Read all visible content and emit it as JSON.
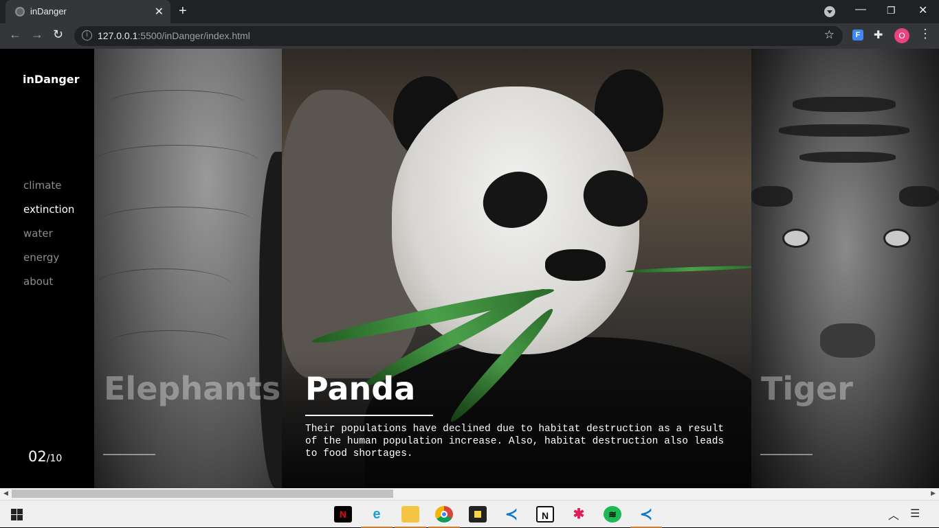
{
  "browser": {
    "tab_title": "inDanger",
    "url_host": "127.0.0.1",
    "url_rest": ":5500/inDanger/index.html",
    "avatar_letter": "O"
  },
  "site": {
    "logo": "inDanger",
    "nav": [
      "climate",
      "extinction",
      "water",
      "energy",
      "about"
    ],
    "active_nav": "extinction",
    "counter_current": "02",
    "counter_total": "/10"
  },
  "panels": [
    {
      "title": "Elephants",
      "state": "inactive"
    },
    {
      "title": "Panda",
      "state": "active",
      "description": "Their populations have declined due to habitat destruction as a result of the human population increase. Also, habitat destruction also leads to food shortages."
    },
    {
      "title": "Tiger",
      "state": "inactive"
    }
  ],
  "taskbar": {
    "apps": [
      "netflix-icon",
      "edge-icon",
      "file-explorer-icon",
      "chrome-icon",
      "sticky-notes-icon",
      "vscode-icon",
      "notion-icon",
      "slack-icon",
      "spotify-icon",
      "vscode-icon"
    ],
    "colors": {
      "accent": "#cc7a2a"
    }
  }
}
